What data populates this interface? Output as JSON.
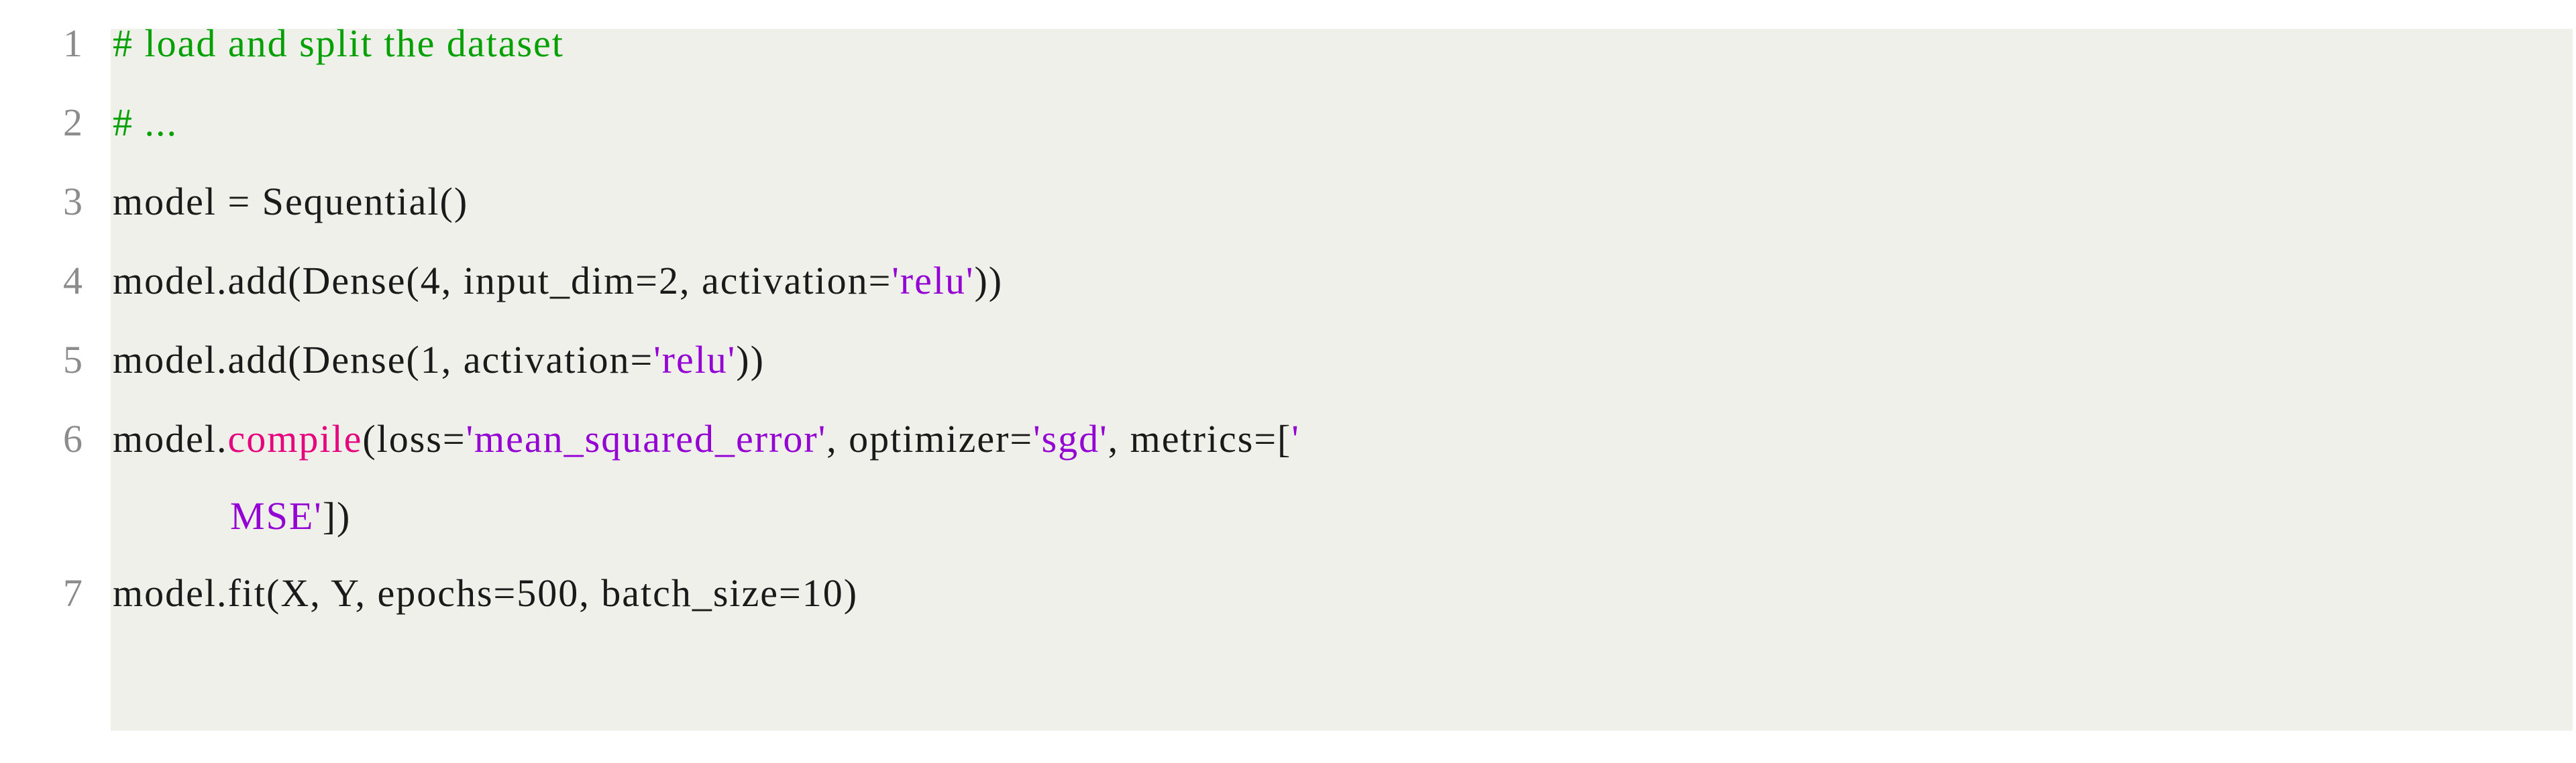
{
  "listing": {
    "language": "Python",
    "background_color": "#eff0e9",
    "page_background": "#ffffff",
    "line_number_color": "#8c8c8c",
    "colors": {
      "comment": "#00a000",
      "string": "#9400d3",
      "method": "#e6007e",
      "plain": "#1a1a1a"
    },
    "lines": [
      {
        "number": "1",
        "text": "# load and split the dataset",
        "tokens": [
          {
            "text": "# load and split the dataset",
            "kind": "comment"
          }
        ]
      },
      {
        "number": "2",
        "text": "# ...",
        "tokens": [
          {
            "text": "# ...",
            "kind": "comment"
          }
        ]
      },
      {
        "number": "3",
        "text": "model = Sequential()",
        "tokens": [
          {
            "text": "model = Sequential()",
            "kind": "plain"
          }
        ]
      },
      {
        "number": "4",
        "text": "model.add(Dense(4, input_dim=2, activation='relu'))",
        "tokens": [
          {
            "text": "model.add(Dense(4, input_dim=2, activation=",
            "kind": "plain"
          },
          {
            "text": "'relu'",
            "kind": "string"
          },
          {
            "text": "))",
            "kind": "plain"
          }
        ]
      },
      {
        "number": "5",
        "text": "model.add(Dense(1, activation='relu'))",
        "tokens": [
          {
            "text": "model.add(Dense(1, activation=",
            "kind": "plain"
          },
          {
            "text": "'relu'",
            "kind": "string"
          },
          {
            "text": "))",
            "kind": "plain"
          }
        ]
      },
      {
        "number": "6",
        "text": "model.compile(loss='mean_squared_error', optimizer='sgd', metrics=['",
        "tokens": [
          {
            "text": "model.",
            "kind": "plain"
          },
          {
            "text": "compile",
            "kind": "method"
          },
          {
            "text": "(loss=",
            "kind": "plain"
          },
          {
            "text": "'mean_squared_error'",
            "kind": "string"
          },
          {
            "text": ", optimizer=",
            "kind": "plain"
          },
          {
            "text": "'sgd'",
            "kind": "string"
          },
          {
            "text": ", metrics=[",
            "kind": "plain"
          },
          {
            "text": "'",
            "kind": "string"
          }
        ]
      },
      {
        "number": "",
        "continuation": true,
        "text": "MSE'])",
        "tokens": [
          {
            "text": "MSE'",
            "kind": "string"
          },
          {
            "text": "])",
            "kind": "plain"
          }
        ]
      },
      {
        "number": "7",
        "text": "model.fit(X, Y, epochs=500, batch_size=10)",
        "tokens": [
          {
            "text": "model.fit(X, Y, epochs=500, batch_size=10)",
            "kind": "plain"
          }
        ]
      }
    ]
  }
}
